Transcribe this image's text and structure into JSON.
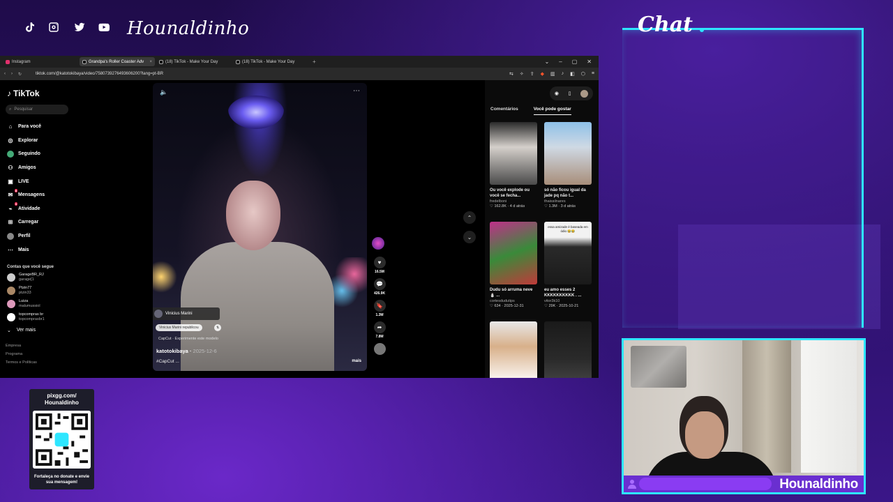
{
  "stream": {
    "brand": "Hounaldinho",
    "social_icons": [
      "tiktok-icon",
      "instagram-icon",
      "twitter-icon",
      "youtube-icon"
    ]
  },
  "browser": {
    "tabs": [
      {
        "label": "Instagram",
        "icon": "instagram-icon",
        "active": false
      },
      {
        "label": "Grandpa's Roller Coaster Adv",
        "icon": "tiktok-icon",
        "active": true
      },
      {
        "label": "(18) TikTok - Make Your Day",
        "icon": "tiktok-icon",
        "active": false
      },
      {
        "label": "(18) TikTok - Make Your Day",
        "icon": "tiktok-icon",
        "active": false
      }
    ],
    "url": "tiktok.com/@katotokibaya/video/7580739276493606200?lang=pt-BR"
  },
  "tiktok": {
    "logo": "TikTok",
    "search_placeholder": "Pesquisar",
    "nav": [
      {
        "label": "Para você",
        "icon": "home-icon"
      },
      {
        "label": "Explorar",
        "icon": "compass-icon"
      },
      {
        "label": "Seguindo",
        "icon": "avatar-icon"
      },
      {
        "label": "Amigos",
        "icon": "friends-icon"
      },
      {
        "label": "LIVE",
        "icon": "live-icon"
      },
      {
        "label": "Mensagens",
        "icon": "message-icon",
        "badge": "8"
      },
      {
        "label": "Atividade",
        "icon": "activity-icon",
        "badge": "3"
      },
      {
        "label": "Carregar",
        "icon": "upload-icon"
      },
      {
        "label": "Perfil",
        "icon": "profile-icon"
      },
      {
        "label": "Mais",
        "icon": "more-icon"
      }
    ],
    "following_header": "Contas que você segue",
    "following": [
      {
        "name": "GarageBR_RJ",
        "handle": "garage[1"
      },
      {
        "name": "Ptzin77",
        "handle": "ptzin33"
      },
      {
        "name": "Luiza",
        "handle": "malumussiol"
      },
      {
        "name": "topcompras br",
        "handle": "topcomprasbr1"
      }
    ],
    "see_more": "Ver mais",
    "footer": [
      "Empresa",
      "Programa",
      "Termos e Políticas"
    ],
    "video": {
      "caption_user": "Vinicius Marini",
      "chip": "Vinicius Marini republicou",
      "capcut": "CapCut · Experimente este modelo",
      "author": "katotokibaya",
      "date": "2025-12-6",
      "tag": "#CapCut ...",
      "more": "mais"
    },
    "actions": [
      {
        "icon": "heart-icon",
        "count": "16.5M"
      },
      {
        "icon": "comment-icon",
        "count": "426.9K"
      },
      {
        "icon": "bookmark-icon",
        "count": "1.3M"
      },
      {
        "icon": "share-icon",
        "count": "7.8M"
      }
    ],
    "right_tabs": [
      "Comentários",
      "Você pode gostar"
    ],
    "active_right_tab": 1,
    "cards": [
      {
        "title": "Ou você explode ou você se fecha...",
        "user": "fredelboni",
        "likes": "162.8K",
        "date": "4 d atrás",
        "thumb_text": ""
      },
      {
        "title": "só não ficou igual da jade pq não t...",
        "user": "thaissilnares",
        "likes": "1.3M",
        "date": "3 d atrás",
        "thumb_text": ""
      },
      {
        "title": "Dudu só arruma neve ⛄ ...",
        "user": "cortesdudutips",
        "likes": "634",
        "date": "2025-12-31",
        "thumb_text": ""
      },
      {
        "title": "eu amo esses 2 KKKKKKKKKK . ...",
        "user": "vitor3k10",
        "likes": "29K",
        "date": "2025-10-21",
        "thumb_text": "essa amizade é baseada em ódio 😂😂"
      },
      {
        "title": "",
        "user": "",
        "likes": "",
        "date": "",
        "thumb_text": ""
      },
      {
        "title": "",
        "user": "",
        "likes": "",
        "date": "",
        "thumb_text": ""
      }
    ]
  },
  "chat": {
    "title": "Chat"
  },
  "webcam": {
    "name": "Hounaldinho"
  },
  "qr": {
    "header": "pixgg.com/ Hounaldinho",
    "footer": "Fortaleça no donate e envie sua mensagem!"
  },
  "colors": {
    "accent": "#2ee6ff",
    "purple": "#6a2fd0",
    "tiktok_red": "#fe2c55"
  }
}
